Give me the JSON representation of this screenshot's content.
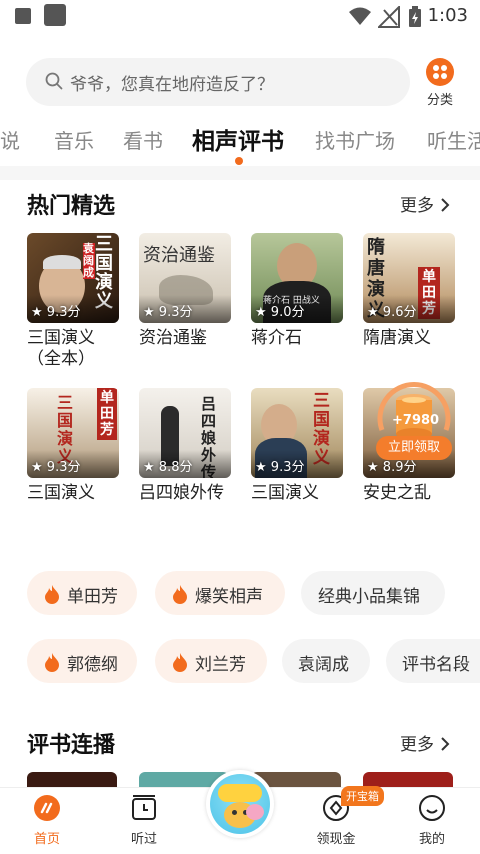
{
  "status_bar": {
    "time": "1:03"
  },
  "search": {
    "placeholder": "爷爷，您真在地府造反了？"
  },
  "category_button": {
    "label": "分类"
  },
  "tabs": [
    {
      "label": "小说"
    },
    {
      "label": "音乐"
    },
    {
      "label": "看书"
    },
    {
      "label": "相声评书",
      "active": true
    },
    {
      "label": "找书广场"
    },
    {
      "label": "听生活"
    }
  ],
  "hot_section": {
    "title": "热门精选",
    "more": "更多",
    "books": [
      {
        "title": "三国演义（全本）",
        "rating": "9.3分",
        "cover_text": "三国演义",
        "cover_sub": "袁阔成"
      },
      {
        "title": "资治通鉴",
        "rating": "9.3分",
        "cover_text": "资治通鉴"
      },
      {
        "title": "蒋介石",
        "rating": "9.0分",
        "cover_text": "蒋介石 田战义"
      },
      {
        "title": "隋唐演义",
        "rating": "9.6分",
        "cover_text": "隋唐演义",
        "cover_sub": "单田芳"
      },
      {
        "title": "三国演义",
        "rating": "9.3分",
        "cover_text": "三国演义",
        "cover_sub": "单田芳"
      },
      {
        "title": "吕四娘外传",
        "rating": "8.8分",
        "cover_text": "吕四娘外传"
      },
      {
        "title": "三国演义",
        "rating": "9.3分",
        "cover_text": "三国演义"
      },
      {
        "title": "安史之乱",
        "rating": "8.9分"
      }
    ]
  },
  "reward": {
    "amount": "+7980",
    "button": "立即领取"
  },
  "chips": [
    {
      "label": "单田芳",
      "flame": true
    },
    {
      "label": "爆笑相声",
      "flame": true
    },
    {
      "label": "经典小品集锦",
      "flame": false
    },
    {
      "label": "郭德纲",
      "flame": true
    },
    {
      "label": "刘兰芳",
      "flame": true
    },
    {
      "label": "袁阔成",
      "flame": false
    },
    {
      "label": "评书名段",
      "flame": false
    }
  ],
  "serial_section": {
    "title": "评书连播",
    "more": "更多"
  },
  "bottom_nav": {
    "items": [
      {
        "label": "首页",
        "active": true
      },
      {
        "label": "听过"
      },
      {
        "label": "领现金"
      },
      {
        "label": "我的"
      }
    ],
    "badge": "开宝箱"
  },
  "colors": {
    "accent": "#f26b1d"
  }
}
